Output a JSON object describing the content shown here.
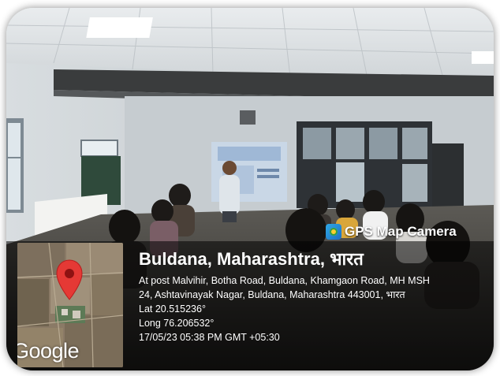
{
  "overlay": {
    "app_name": "GPS Map Camera",
    "app_icon": "gps-map-camera-icon",
    "location_title": "Buldana, Maharashtra, भारत",
    "address_line1": "At post Malvihir, Botha Road, Buldana, Khamgaon Road, MH MSH",
    "address_line2": "24, Ashtavinayak Nagar, Buldana, Maharashtra 443001, भारत",
    "lat": "Lat 20.515236°",
    "long": "Long 76.206532°",
    "datetime": "17/05/23 05:38 PM GMT +05:30"
  },
  "map": {
    "logo_text": "Google",
    "pin_color": "#e53935"
  },
  "photo": {
    "scene": "classroom-presentation"
  }
}
